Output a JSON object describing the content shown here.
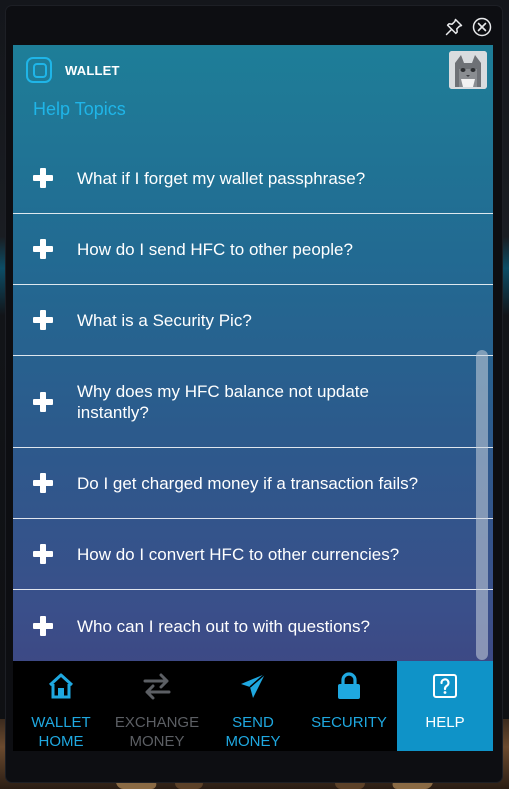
{
  "header": {
    "app_name": "WALLET",
    "heading": "Help Topics"
  },
  "faq": [
    {
      "question": "What if I forget my wallet passphrase?"
    },
    {
      "question": "How do I send HFC to other people?"
    },
    {
      "question": "What is a Security Pic?"
    },
    {
      "question": "Why does my HFC balance not update instantly?"
    },
    {
      "question": "Do I get charged money if a transaction fails?"
    },
    {
      "question": "How do I convert HFC to other currencies?"
    },
    {
      "question": "Who can I reach out to with questions?"
    }
  ],
  "nav": {
    "home": {
      "line1": "WALLET",
      "line2": "HOME"
    },
    "exchange": {
      "line1": "EXCHANGE",
      "line2": "MONEY"
    },
    "send": {
      "line1": "SEND",
      "line2": "MONEY"
    },
    "security": {
      "line1": "SECURITY"
    },
    "help": {
      "line1": "HELP"
    }
  },
  "icons": {
    "pin": "pin-icon",
    "close": "close-icon",
    "faq_expand": "plus-icon",
    "home": "home-icon",
    "exchange": "exchange-arrows-icon",
    "send": "paper-plane-icon",
    "security": "lock-icon",
    "help": "question-box-icon"
  },
  "colors": {
    "accent": "#1fa8e0",
    "active_tab": "#0f93c8",
    "disabled": "#5c5f64"
  }
}
